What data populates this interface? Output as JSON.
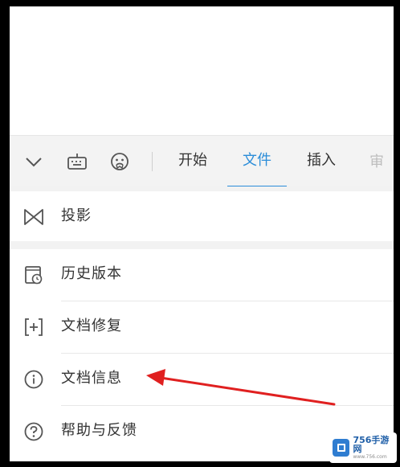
{
  "toolbar": {
    "icons": [
      "chevron-down-icon",
      "keyboard-icon",
      "emoji-icon"
    ],
    "tabs": [
      {
        "label": "开始",
        "active": false
      },
      {
        "label": "文件",
        "active": true
      },
      {
        "label": "插入",
        "active": false
      }
    ],
    "accent_color": "#2b8dd9"
  },
  "menu": {
    "projection": {
      "label": "投影",
      "icon": "projection-icon"
    },
    "items": [
      {
        "label": "历史版本",
        "icon": "history-version-icon"
      },
      {
        "label": "文档修复",
        "icon": "document-repair-icon"
      },
      {
        "label": "文档信息",
        "icon": "info-icon"
      },
      {
        "label": "帮助与反馈",
        "icon": "help-icon"
      }
    ]
  },
  "annotation": {
    "arrow_color": "#e02020"
  },
  "watermark": {
    "brand": "756手游网",
    "url": "www.756.com"
  }
}
